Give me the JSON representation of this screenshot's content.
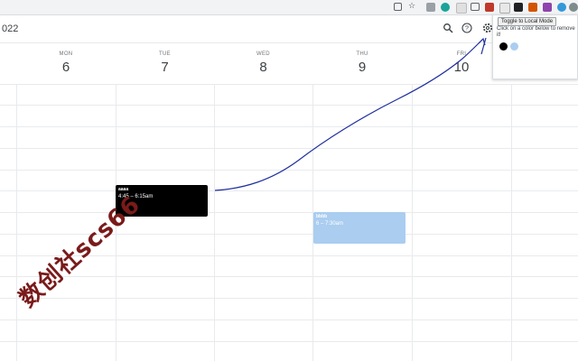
{
  "header": {
    "year_fragment": "022"
  },
  "days": [
    {
      "name": "MON",
      "num": "6"
    },
    {
      "name": "TUE",
      "num": "7"
    },
    {
      "name": "WED",
      "num": "8"
    },
    {
      "name": "THU",
      "num": "9"
    },
    {
      "name": "FRI",
      "num": "10"
    }
  ],
  "events": [
    {
      "title": "aaaa",
      "time": "4:45 – 6:15am",
      "color": "#000000",
      "text_color": "#ffffff"
    },
    {
      "title": "bbbb",
      "time": "6 – 7:30am",
      "color": "#aacdf0",
      "text_color": "#ffffff"
    }
  ],
  "popup": {
    "toggle_label": "Toggle to Local Mode",
    "hint": "Click on a color below to remove it!",
    "swatches": [
      "#000000",
      "#aacdf0"
    ]
  },
  "watermark": "数创社scs66",
  "icons": {
    "search": "search-icon",
    "help": "help-icon",
    "settings": "gear-icon"
  }
}
